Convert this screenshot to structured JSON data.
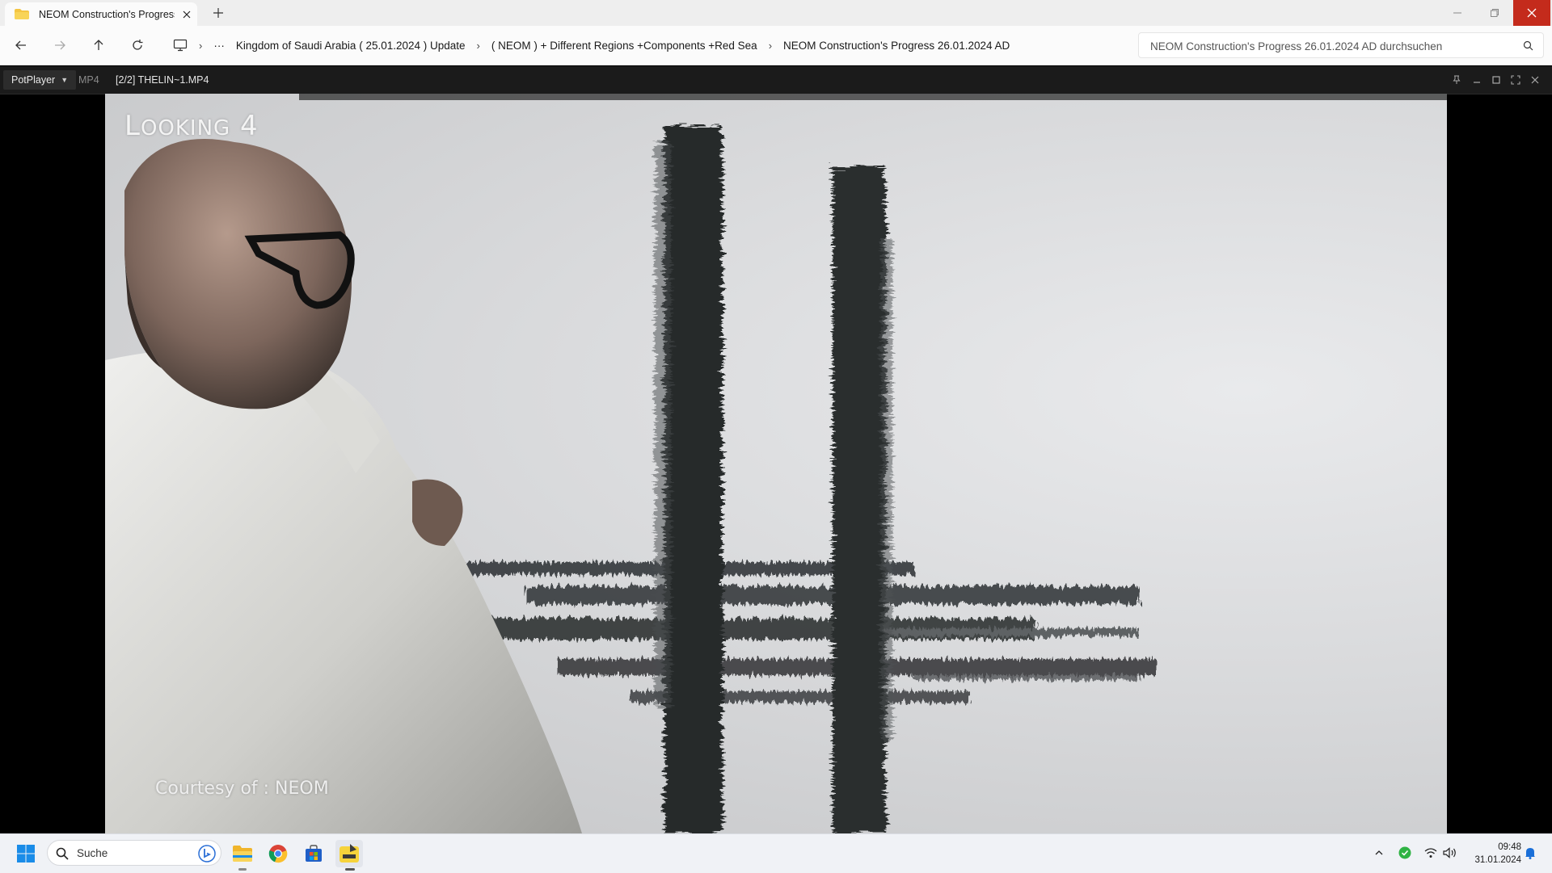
{
  "explorer": {
    "tab_title": "NEOM Construction's Progress 26.01.2024 AD",
    "breadcrumbs": [
      "Kingdom of Saudi Arabia ( 25.01.2024 ) Update",
      "( NEOM ) + Different Regions +Components +Red Sea",
      "NEOM Construction's Progress 26.01.2024 AD"
    ],
    "overflow_label": "···",
    "search_placeholder": "NEOM Construction's Progress 26.01.2024 AD durchsuchen",
    "colors": {
      "close_button": "#c42b1c"
    }
  },
  "player": {
    "app_name": "PotPlayer",
    "format": "MP4",
    "file_label": "[2/2] THELIN~1.MP4",
    "overlay_title_prefix": "L",
    "overlay_title_smallcaps": "OOKING",
    "overlay_title_number": "4",
    "overlay_credit": "Courtesy of : NEOM"
  },
  "taskbar": {
    "search_placeholder": "Suche",
    "clock_time": "09:48",
    "clock_date": "31.01.2024",
    "pinned": [
      "windows-start-icon",
      "file-explorer-icon",
      "chrome-icon",
      "microsoft-store-icon",
      "potplayer-icon"
    ]
  }
}
